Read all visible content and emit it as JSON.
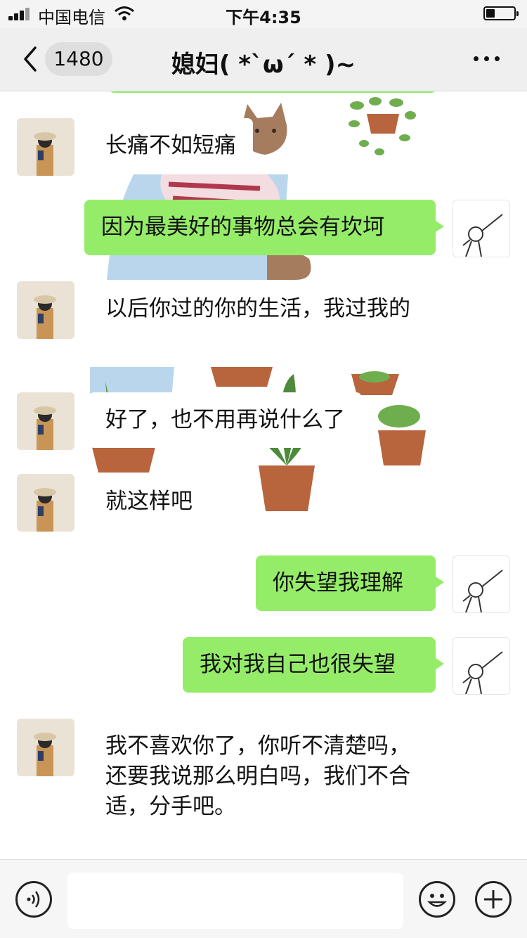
{
  "status_bar": {
    "carrier": "中国电信",
    "time": "下午4:35"
  },
  "nav": {
    "unread_count": "1480",
    "title": "媳妇( *`ω´ * )~"
  },
  "messages": [
    {
      "side": "left",
      "text": "长痛不如短痛"
    },
    {
      "side": "right",
      "text": "因为最美好的事物总会有坎坷"
    },
    {
      "side": "left",
      "text": "以后你过的你的生活，我过我的"
    },
    {
      "side": "left",
      "text": "好了，也不用再说什么了"
    },
    {
      "side": "left",
      "text": "就这样吧"
    },
    {
      "side": "right",
      "text": "你失望我理解"
    },
    {
      "side": "right",
      "text": "我对我自己也很失望"
    },
    {
      "side": "left",
      "text": "我不喜欢你了，你听不清楚吗，还要我说那么明白吗，我们不合适，分手吧。"
    }
  ],
  "input_bar": {
    "voice_icon": "voice-icon",
    "emoji_icon": "emoji-icon",
    "add_icon": "plus-icon",
    "message_value": ""
  },
  "colors": {
    "bubble_mine": "#95ec69",
    "bubble_theirs": "#ffffff",
    "nav_bg": "#efefef"
  }
}
